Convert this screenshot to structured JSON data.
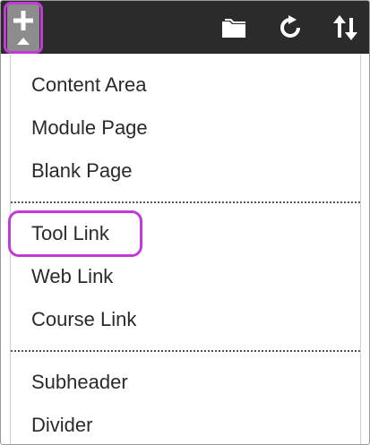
{
  "toolbar": {
    "add_icon": "plus-icon",
    "folder_icon": "folder-icon",
    "refresh_icon": "refresh-icon",
    "sort_icon": "sort-icon",
    "highlight_color": "#c23bd8"
  },
  "menu": {
    "items": [
      {
        "label": "Content Area"
      },
      {
        "label": "Module Page"
      },
      {
        "label": "Blank Page"
      },
      {
        "label": "Tool Link"
      },
      {
        "label": "Web Link"
      },
      {
        "label": "Course Link"
      },
      {
        "label": "Subheader"
      },
      {
        "label": "Divider"
      }
    ]
  }
}
